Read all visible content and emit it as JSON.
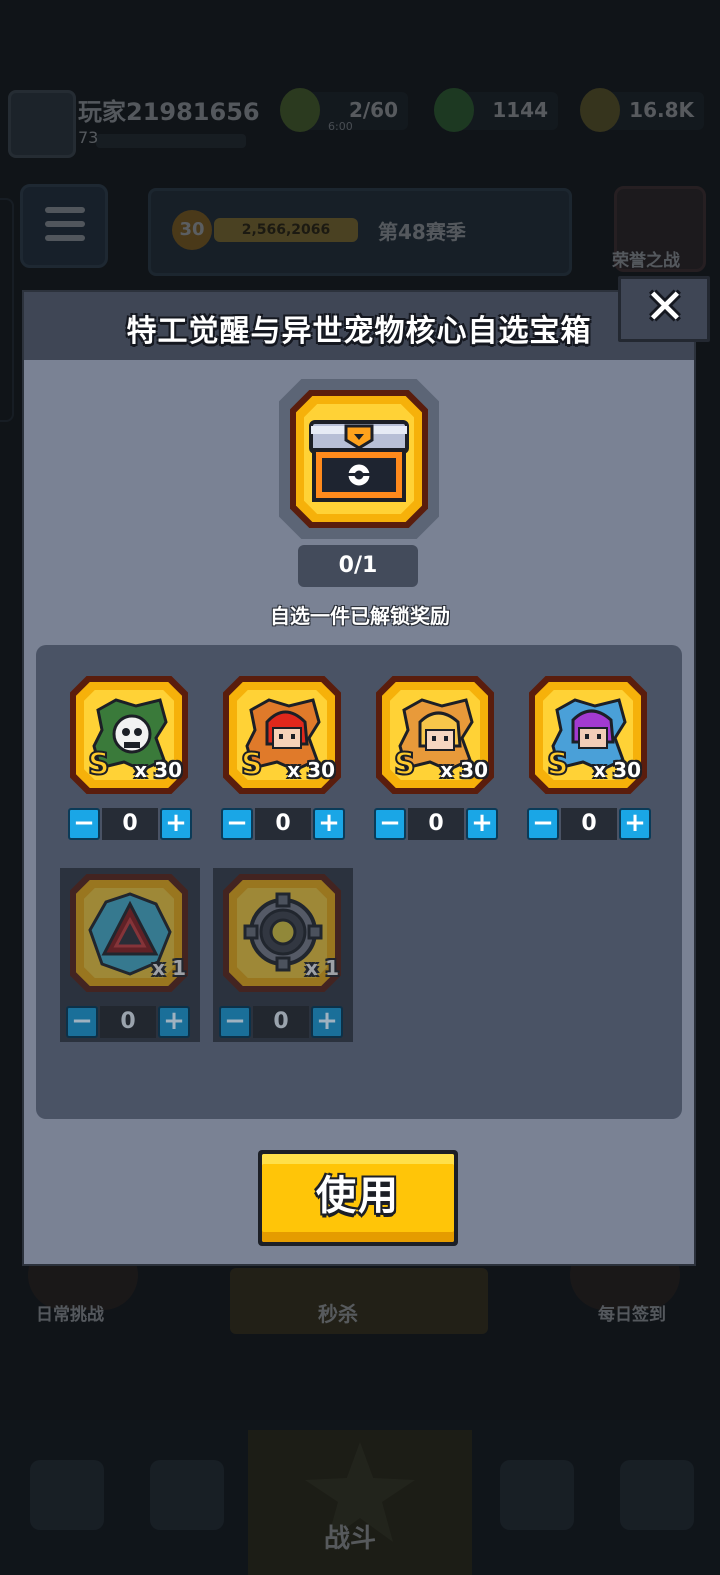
{
  "background_hud": {
    "player_name": "玩家21981656",
    "player_level": "73",
    "resources": [
      {
        "icon": "stamina-icon",
        "value": "2/60",
        "sub": "6:00"
      },
      {
        "icon": "gem-icon",
        "value": "1144",
        "sub": ""
      },
      {
        "icon": "gold-icon",
        "value": "16.8K",
        "sub": ""
      }
    ],
    "stage_level": "30",
    "stage_power": "2,566,2066",
    "stage_name": "第48赛季",
    "shield_label": "荣誉之战",
    "bottom_left_label": "日常挑战",
    "bottom_mid_label": "秒杀",
    "bottom_right_label": "每日签到",
    "nav_center_label": "战斗"
  },
  "dialog": {
    "title": "特工觉醒与异世宠物核心自选宝箱",
    "close_icon": "close-icon",
    "chest_icon": "treasure-chest-icon",
    "counter": "0/1",
    "hint": "自选一件已解锁奖励",
    "rewards": [
      {
        "icon": "agent-skull-shard-icon",
        "quantity": "x 30",
        "count": "0",
        "locked": false
      },
      {
        "icon": "agent-redhair-shard-icon",
        "quantity": "x 30",
        "count": "0",
        "locked": false
      },
      {
        "icon": "agent-blonde-shard-icon",
        "quantity": "x 30",
        "count": "0",
        "locked": false
      },
      {
        "icon": "agent-purple-shard-icon",
        "quantity": "x 30",
        "count": "0",
        "locked": false
      },
      {
        "icon": "pet-core-crystal-icon",
        "quantity": "x 1",
        "count": "0",
        "locked": true
      },
      {
        "icon": "pet-core-ring-icon",
        "quantity": "x 1",
        "count": "0",
        "locked": true
      }
    ],
    "minus_icon": "minus-icon",
    "plus_icon": "plus-icon",
    "use_button": "使用"
  },
  "colors": {
    "dialog_bg": "#7a8294",
    "header_bg": "#3f4655",
    "panel_bg": "#4a5365",
    "tile_gold": "#f6b10a",
    "stepper_blue": "#1aa6e6",
    "button_yellow": "#ffc508"
  }
}
